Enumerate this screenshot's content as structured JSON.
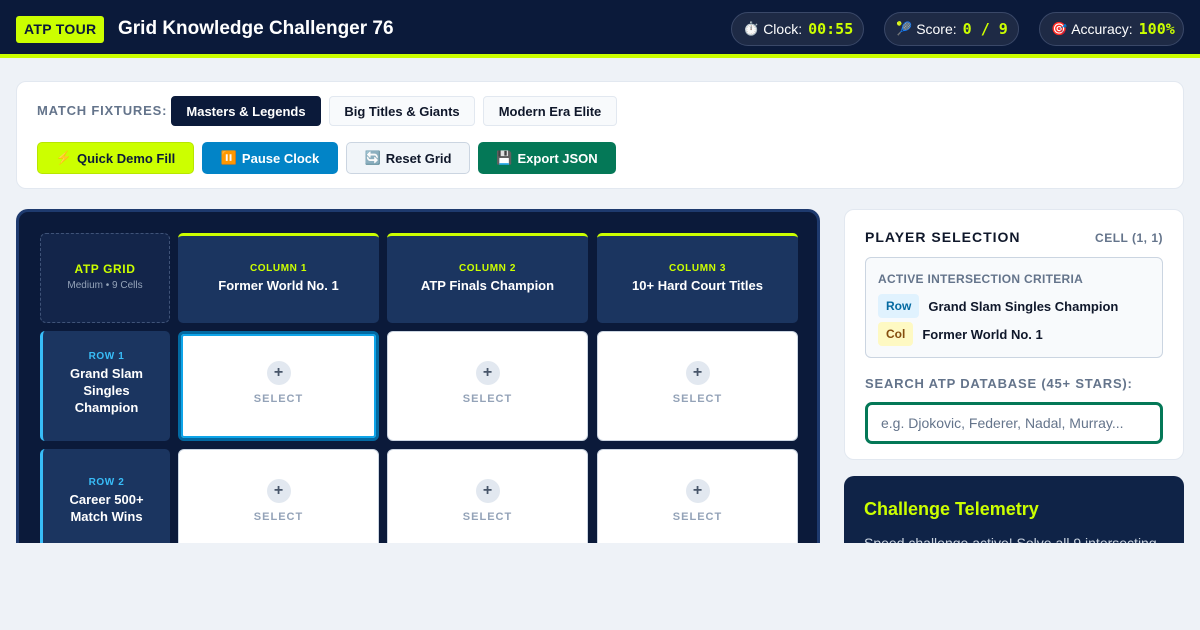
{
  "header": {
    "brand": "ATP TOUR",
    "title": "Grid Knowledge Challenger 76",
    "clock_label": "Clock:",
    "clock_value": "00:55",
    "score_label": "Score:",
    "score_value": "0 / 9",
    "accuracy_label": "Accuracy:",
    "accuracy_value": "100%",
    "icons": {
      "clock": "stopwatch-icon",
      "score": "tennis-icon",
      "accuracy": "target-icon"
    },
    "accent_color": "#ccff00",
    "background_color": "#0b1a3a"
  },
  "fixtures": {
    "label": "MATCH FIXTURES:",
    "chips": [
      {
        "label": "Masters & Legends",
        "active": true
      },
      {
        "label": "Big Titles & Giants",
        "active": false
      },
      {
        "label": "Modern Era Elite",
        "active": false
      }
    ]
  },
  "actions": {
    "demo": {
      "icon": "⚡",
      "label": "Quick Demo Fill"
    },
    "pause": {
      "icon": "⏸️",
      "label": "Pause Clock"
    },
    "reset": {
      "icon": "🔄",
      "label": "Reset Grid"
    },
    "export": {
      "icon": "💾",
      "label": "Export JSON"
    }
  },
  "grid": {
    "corner_title": "ATP GRID",
    "corner_subtitle": "Medium • 9 Cells",
    "columns": [
      {
        "tag": "COLUMN 1",
        "name": "Former World No. 1"
      },
      {
        "tag": "COLUMN 2",
        "name": "ATP Finals Champion"
      },
      {
        "tag": "COLUMN 3",
        "name": "10+ Hard Court Titles"
      }
    ],
    "rows": [
      {
        "tag": "ROW 1",
        "name": "Grand Slam Singles Champion"
      },
      {
        "tag": "ROW 2",
        "name": "Career 500+ Match Wins"
      }
    ],
    "cell_label": "SELECT",
    "cell_icon": "+"
  },
  "selection": {
    "title": "PLAYER SELECTION",
    "cell_ref": "CELL (1, 1)",
    "criteria_title": "ACTIVE INTERSECTION CRITERIA",
    "row_tag": "Row",
    "row_value": "Grand Slam Singles Champion",
    "col_tag": "Col",
    "col_value": "Former World No. 1",
    "search_label": "SEARCH ATP DATABASE (45+ STARS):",
    "search_placeholder": "e.g. Djokovic, Federer, Nadal, Murray..."
  },
  "telemetry": {
    "title": "Challenge Telemetry",
    "text": "Speed challenge active! Solve all 9 intersecting"
  }
}
